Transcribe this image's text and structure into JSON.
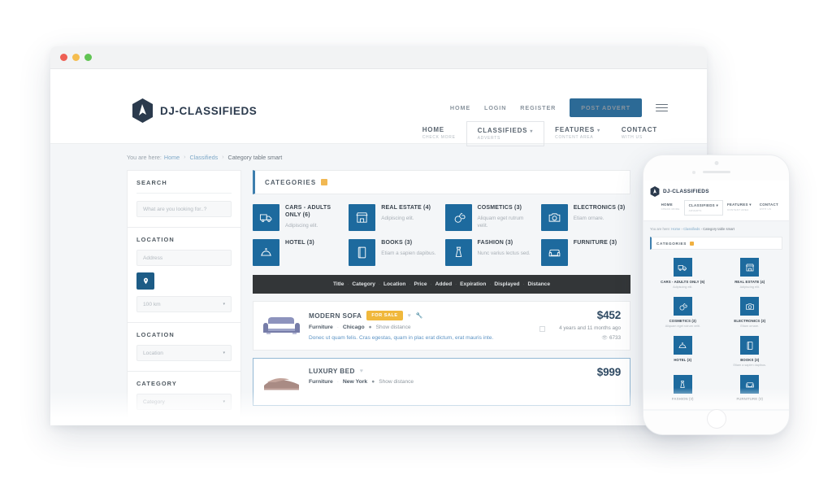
{
  "browser": {
    "dots": [
      "close",
      "minimize",
      "maximize"
    ]
  },
  "site": {
    "logo_text": "DJ-CLASSIFIEDS",
    "top_links": [
      {
        "label": "HOME"
      },
      {
        "label": "LOGIN"
      },
      {
        "label": "REGISTER"
      }
    ],
    "cta_label": "POST ADVERT",
    "main_nav": [
      {
        "label": "HOME",
        "sub": "CHECK MORE",
        "caret": false,
        "boxed": false
      },
      {
        "label": "CLASSIFIEDS",
        "sub": "ADVERTS",
        "caret": true,
        "boxed": true
      },
      {
        "label": "FEATURES",
        "sub": "CONTENT AREA",
        "caret": true,
        "boxed": false
      },
      {
        "label": "CONTACT",
        "sub": "WITH US",
        "caret": false,
        "boxed": false
      }
    ]
  },
  "breadcrumb": {
    "prefix": "You are here:",
    "home": "Home",
    "classifieds": "Classifieds",
    "separator": "›",
    "current": "Category table smart"
  },
  "sidebar": {
    "search_title": "SEARCH",
    "search_placeholder": "What are you looking for..?",
    "location_title": "LOCATION",
    "address_placeholder": "Address",
    "geo_icon": "map-pin-icon",
    "radius_value": "100 km",
    "location2_title": "LOCATION",
    "location2_value": "Location",
    "category_title": "CATEGORY",
    "category_value": "Category"
  },
  "categories_header": {
    "title": "CATEGORIES",
    "icon": "grid-icon"
  },
  "categories": [
    {
      "name": "CARS - ADULTS ONLY (6)",
      "desc": "Adipiscing elit.",
      "icon": "truck-icon"
    },
    {
      "name": "REAL ESTATE (4)",
      "desc": "Adipiscing elit.",
      "icon": "store-icon"
    },
    {
      "name": "COSMETICS (3)",
      "desc": "Aliquam eget rutrum velit.",
      "icon": "perfume-icon"
    },
    {
      "name": "ELECTRONICS (3)",
      "desc": "Etiam ornare.",
      "icon": "camera-icon"
    },
    {
      "name": "HOTEL (3)",
      "desc": "",
      "icon": "cloche-icon"
    },
    {
      "name": "BOOKS (3)",
      "desc": "Etiam a sapien dapibus.",
      "icon": "book-icon"
    },
    {
      "name": "FASHION (3)",
      "desc": "Nunc varius lectus sed.",
      "icon": "dress-icon"
    },
    {
      "name": "FURNITURE (3)",
      "desc": "",
      "icon": "sofa-icon"
    }
  ],
  "sort_bar": {
    "columns": [
      "Title",
      "Category",
      "Location",
      "Price",
      "Added",
      "Expiration",
      "Displayed",
      "Distance"
    ],
    "separator": "·"
  },
  "listings": [
    {
      "title": "MODERN SOFA",
      "badge": "FOR SALE",
      "favorite_icon": "heart-icon",
      "tool_icon": "wrench-icon",
      "category": "Furniture",
      "location": "Chicago",
      "distance_label": "Show distance",
      "description": "Donec ut quam felis. Cras egestas, quam in plac erat dictum, erat mauris inte.",
      "price": "$452",
      "age": "4 years and 11 months ago",
      "views": "6733",
      "thumb": "sofa-photo"
    },
    {
      "title": "LUXURY BED",
      "badge": "",
      "favorite_icon": "heart-icon",
      "tool_icon": "",
      "category": "Furniture",
      "location": "New York",
      "distance_label": "Show distance",
      "description": "",
      "price": "$999",
      "age": "",
      "views": "",
      "thumb": "bed-photo"
    }
  ],
  "phone": {
    "logo_text": "DJ-CLASSIFIEDS",
    "nav": [
      {
        "label": "HOME",
        "sub": "CHECK MORE",
        "boxed": false,
        "caret": false
      },
      {
        "label": "CLASSIFIEDS",
        "sub": "ADVERTS",
        "boxed": true,
        "caret": true
      },
      {
        "label": "FEATURES",
        "sub": "CONTENT AREA",
        "boxed": false,
        "caret": true
      },
      {
        "label": "CONTACT",
        "sub": "WITH US",
        "boxed": false,
        "caret": false
      }
    ],
    "breadcrumb_prefix": "You are here:",
    "breadcrumb_home": "Home",
    "breadcrumb_classifieds": "Classifieds",
    "breadcrumb_current": "Category table smart",
    "categories_title": "CATEGORIES",
    "categories": [
      {
        "name": "CARS - ADULTS ONLY (6)",
        "desc": "Adipiscing elit.",
        "icon": "truck-icon"
      },
      {
        "name": "REAL ESTATE (4)",
        "desc": "Adipiscing elit.",
        "icon": "store-icon"
      },
      {
        "name": "COSMETICS (3)",
        "desc": "Aliquam eget rutrum velit.",
        "icon": "perfume-icon"
      },
      {
        "name": "ELECTRONICS (3)",
        "desc": "Etiam ornare.",
        "icon": "camera-icon"
      },
      {
        "name": "HOTEL (3)",
        "desc": "",
        "icon": "cloche-icon"
      },
      {
        "name": "BOOKS (3)",
        "desc": "Etiam a sapien dapibus.",
        "icon": "book-icon"
      },
      {
        "name": "FASHION (3)",
        "desc": "",
        "icon": "dress-icon"
      },
      {
        "name": "FURNITURE (3)",
        "desc": "",
        "icon": "sofa-icon"
      }
    ]
  },
  "colors": {
    "tile_blue": "#1d6a9e",
    "cta_blue": "#2c6a96",
    "badge_amber": "#f0b83c",
    "price_navy": "#2f4a63",
    "sortbar_dark": "#333638",
    "link_blue": "#5c93c4"
  }
}
